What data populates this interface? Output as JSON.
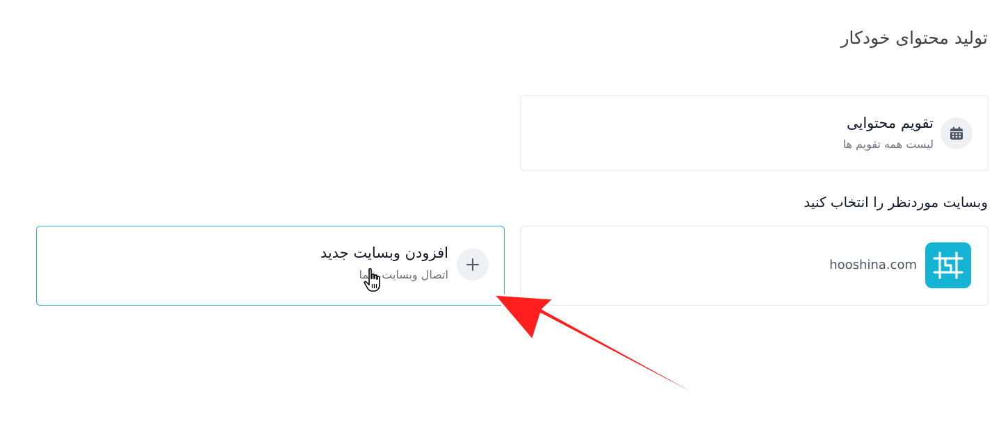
{
  "page": {
    "title": "تولید محتوای خودکار"
  },
  "calendar_card": {
    "icon": "calendar-icon",
    "title": "تقویم محتوایی",
    "subtitle": "لیست همه تقویم ها"
  },
  "website_section": {
    "label": "وبسایت موردنظر را انتخاب کنید",
    "sites": [
      {
        "logo": "hooshina-logo",
        "domain": "hooshina.com"
      }
    ],
    "add_card": {
      "icon": "plus-icon",
      "title": "افزودن وبسایت جدید",
      "subtitle": "اتصال وبسایت شما"
    }
  },
  "annotation": {
    "arrow_color": "#ff1f1f",
    "cursor": "hand-pointer-icon"
  },
  "colors": {
    "accent_border": "#2bb3d8",
    "logo_bg": "#15b4d4"
  }
}
